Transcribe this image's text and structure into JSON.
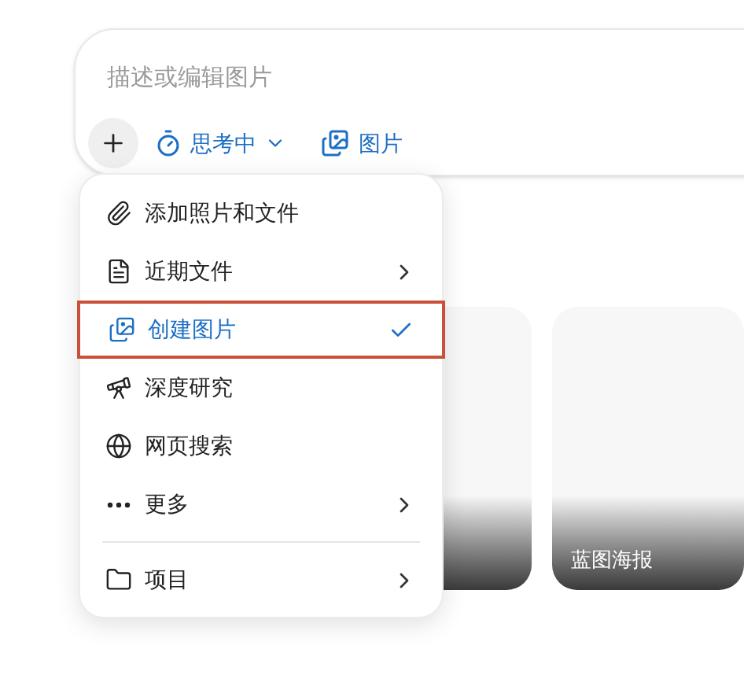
{
  "composer": {
    "placeholder": "描述或编辑图片",
    "mode": {
      "label": "思考中"
    },
    "tool": {
      "label": "图片"
    }
  },
  "menu": {
    "items": [
      {
        "kind": "item",
        "label": "添加照片和文件",
        "submenu": false,
        "selected": false,
        "highlighted": false
      },
      {
        "kind": "item",
        "label": "近期文件",
        "submenu": true,
        "selected": false,
        "highlighted": false
      },
      {
        "kind": "item",
        "label": "创建图片",
        "submenu": false,
        "selected": true,
        "highlighted": true
      },
      {
        "kind": "item",
        "label": "深度研究",
        "submenu": false,
        "selected": false,
        "highlighted": false
      },
      {
        "kind": "item",
        "label": "网页搜索",
        "submenu": false,
        "selected": false,
        "highlighted": false
      },
      {
        "kind": "item",
        "label": "更多",
        "submenu": true,
        "selected": false,
        "highlighted": false
      },
      {
        "kind": "divider"
      },
      {
        "kind": "item",
        "label": "项目",
        "submenu": true,
        "selected": false,
        "highlighted": false
      }
    ]
  },
  "cards": [
    {
      "kind": "card"
    },
    {
      "kind": "card",
      "label": "蓝图海报"
    }
  ]
}
